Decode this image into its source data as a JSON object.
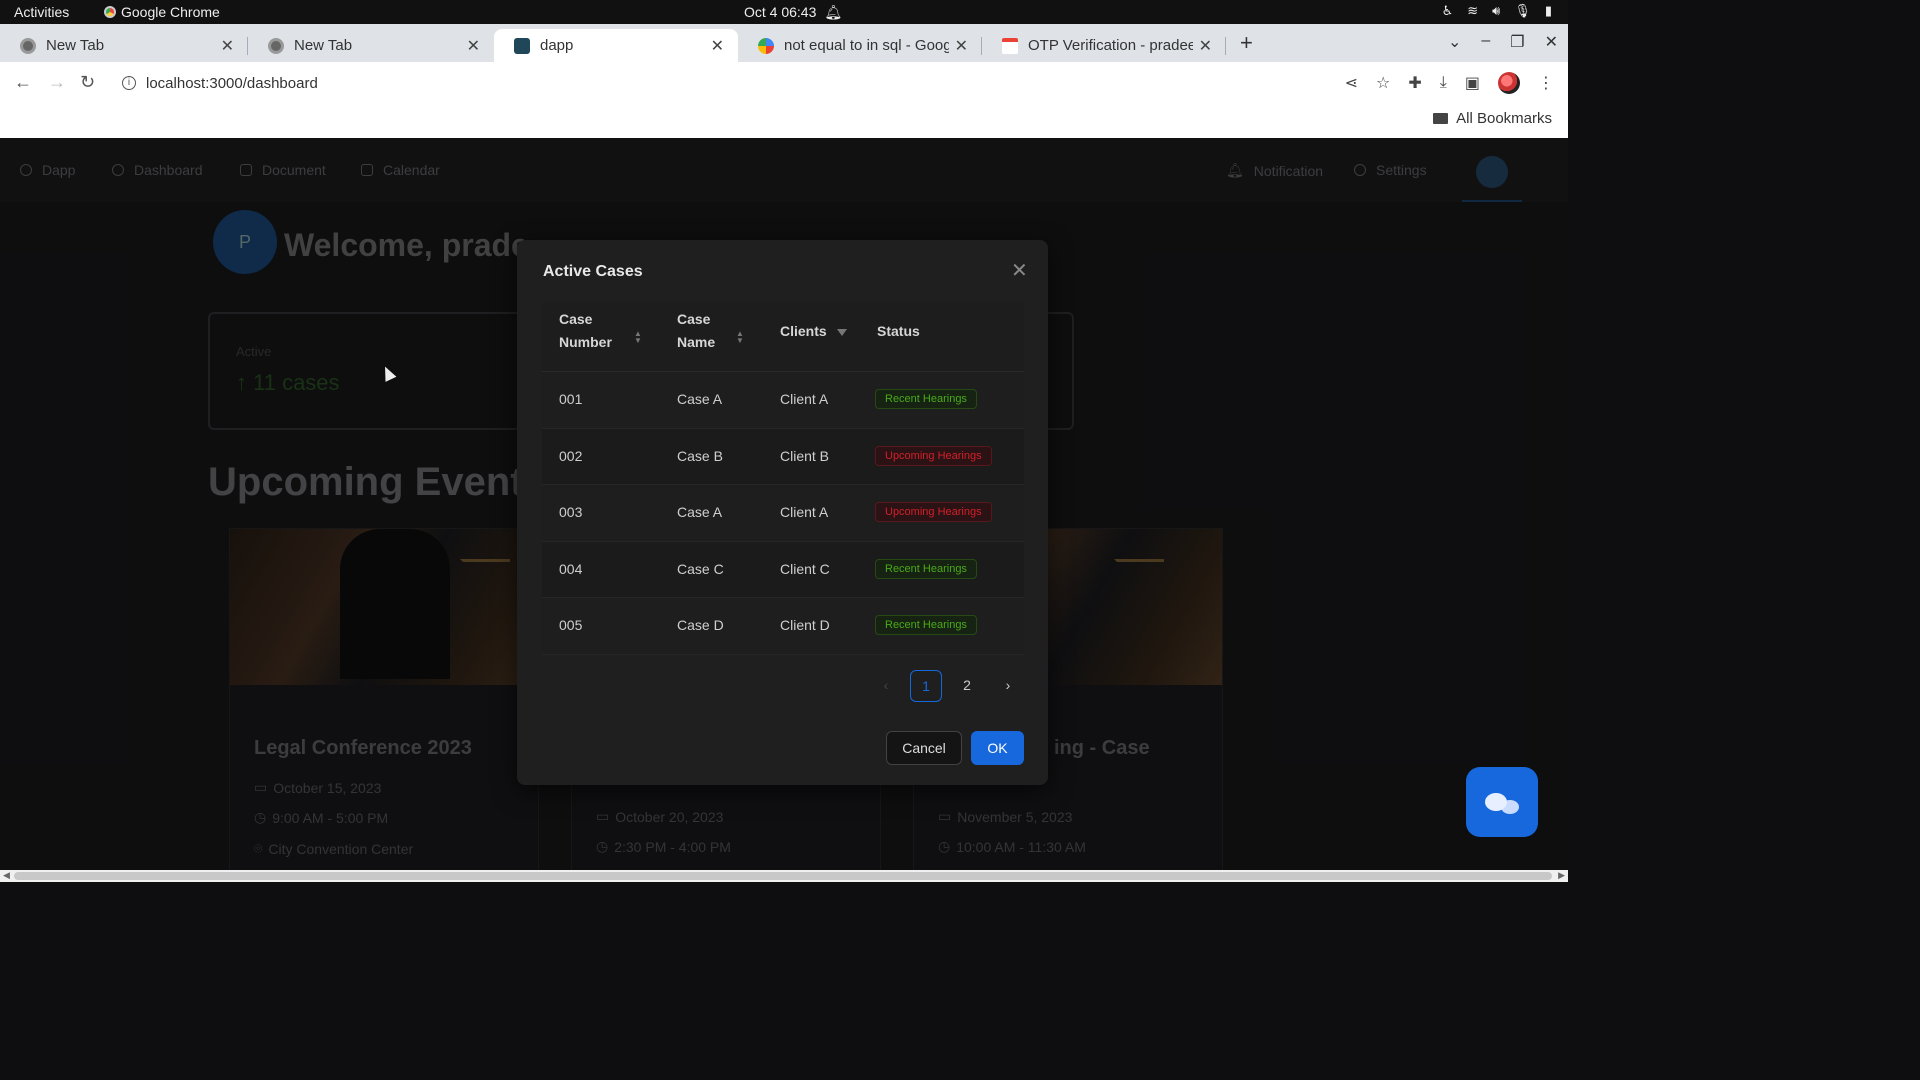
{
  "os": {
    "activities": "Activities",
    "app_name": "Google Chrome",
    "clock": "Oct 4  06:43"
  },
  "browser": {
    "tabs": [
      {
        "label": "New Tab",
        "icon": "chrome-icon"
      },
      {
        "label": "New Tab",
        "icon": "chrome-icon"
      },
      {
        "label": "dapp",
        "icon": "react-icon",
        "active": true
      },
      {
        "label": "not equal to in sql - Goog",
        "icon": "google-icon"
      },
      {
        "label": "OTP Verification - pradee",
        "icon": "gmail-icon"
      }
    ],
    "new_tab": "+",
    "url": "localhost:3000/dashboard",
    "bookmarks_label": "All Bookmarks"
  },
  "nav": {
    "items": [
      {
        "label": "Dapp",
        "icon": "app-icon"
      },
      {
        "label": "Dashboard",
        "icon": "dashboard-icon"
      },
      {
        "label": "Document",
        "icon": "document-icon"
      },
      {
        "label": "Calendar",
        "icon": "calendar-icon"
      }
    ],
    "notification": "Notification",
    "settings": "Settings"
  },
  "welcome": {
    "avatar_initial": "P",
    "text": "Welcome, prade"
  },
  "stat": {
    "label": "Active",
    "value": "↑ 11 cases"
  },
  "upcoming_title": "Upcoming Event",
  "events": [
    {
      "title": "Legal Conference 2023",
      "date": "October 15, 2023",
      "time": "9:00 AM - 5:00 PM",
      "location": "City Convention Center"
    },
    {
      "title": "",
      "date": "October 20, 2023",
      "time": "2:30 PM - 4:00 PM",
      "location": ""
    },
    {
      "title": "ing - Case",
      "date": "November 5, 2023",
      "time": "10:00 AM - 11:30 AM",
      "location": ""
    }
  ],
  "modal": {
    "title": "Active Cases",
    "columns": {
      "case_number": [
        "Case",
        "Number"
      ],
      "case_name": [
        "Case",
        "Name"
      ],
      "clients": "Clients",
      "status": "Status"
    },
    "rows": [
      {
        "number": "001",
        "name": "Case A",
        "client": "Client A",
        "status": "Recent Hearings",
        "status_color": "green"
      },
      {
        "number": "002",
        "name": "Case B",
        "client": "Client B",
        "status": "Upcoming Hearings",
        "status_color": "red"
      },
      {
        "number": "003",
        "name": "Case A",
        "client": "Client A",
        "status": "Upcoming Hearings",
        "status_color": "red"
      },
      {
        "number": "004",
        "name": "Case C",
        "client": "Client C",
        "status": "Recent Hearings",
        "status_color": "green"
      },
      {
        "number": "005",
        "name": "Case D",
        "client": "Client D",
        "status": "Recent Hearings",
        "status_color": "green"
      }
    ],
    "pagination": {
      "prev": "‹",
      "pages": [
        "1",
        "2"
      ],
      "current": "1",
      "next": "›"
    },
    "cancel": "Cancel",
    "ok": "OK"
  },
  "colors": {
    "primary": "#1668dc",
    "tag_green": "#49aa19",
    "tag_red": "#d32029"
  }
}
